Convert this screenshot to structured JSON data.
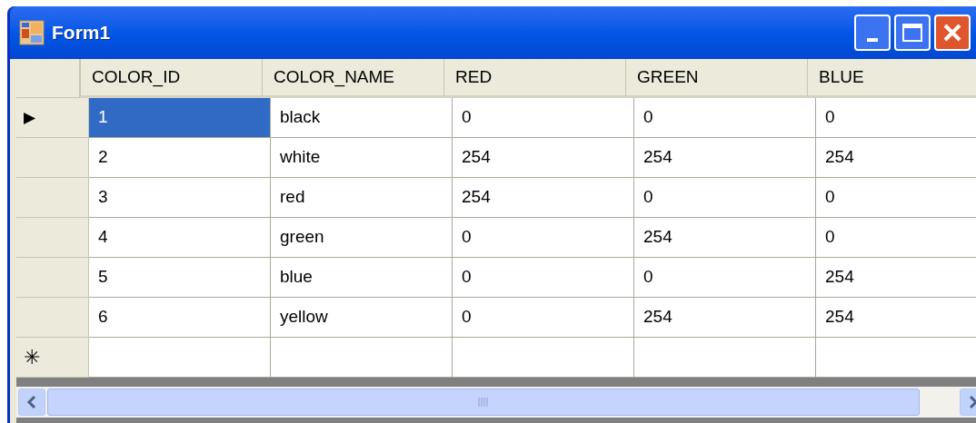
{
  "window": {
    "title": "Form1"
  },
  "grid": {
    "columns": [
      "COLOR_ID",
      "COLOR_NAME",
      "RED",
      "GREEN",
      "BLUE"
    ],
    "rows": [
      {
        "marker": "▶",
        "cells": [
          {
            "text": "1",
            "selected": true
          },
          {
            "text": "black",
            "selected": false
          },
          {
            "text": "0",
            "selected": false
          },
          {
            "text": "0",
            "selected": false
          },
          {
            "text": "0",
            "selected": false
          }
        ]
      },
      {
        "cells": [
          {
            "text": "2",
            "selected": false
          },
          {
            "text": "white",
            "selected": false
          },
          {
            "text": "254",
            "selected": false
          },
          {
            "text": "254",
            "selected": false
          },
          {
            "text": "254",
            "selected": false
          }
        ]
      },
      {
        "cells": [
          {
            "text": "3",
            "selected": false
          },
          {
            "text": "red",
            "selected": false
          },
          {
            "text": "254",
            "selected": false
          },
          {
            "text": "0",
            "selected": false
          },
          {
            "text": "0",
            "selected": false
          }
        ]
      },
      {
        "cells": [
          {
            "text": "4",
            "selected": false
          },
          {
            "text": "green",
            "selected": false
          },
          {
            "text": "0",
            "selected": false
          },
          {
            "text": "254",
            "selected": false
          },
          {
            "text": "0",
            "selected": false
          }
        ]
      },
      {
        "cells": [
          {
            "text": "5",
            "selected": false
          },
          {
            "text": "blue",
            "selected": false
          },
          {
            "text": "0",
            "selected": false
          },
          {
            "text": "0",
            "selected": false
          },
          {
            "text": "254",
            "selected": false
          }
        ]
      },
      {
        "cells": [
          {
            "text": "6",
            "selected": false
          },
          {
            "text": "yellow",
            "selected": false
          },
          {
            "text": "0",
            "selected": false
          },
          {
            "text": "254",
            "selected": false
          },
          {
            "text": "254",
            "selected": false
          }
        ]
      }
    ],
    "new_row": {
      "marker": "✳"
    }
  }
}
